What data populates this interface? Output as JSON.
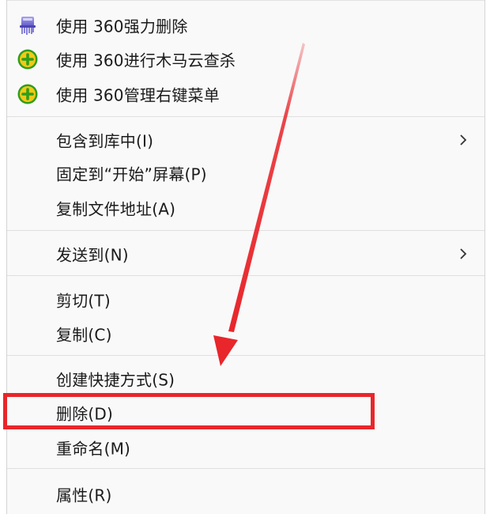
{
  "context_menu": {
    "items": [
      {
        "id": "force-delete",
        "label": "使用 360强力删除",
        "icon": "360-shredder-icon"
      },
      {
        "id": "trojan-scan",
        "label": "使用 360进行木马云查杀",
        "icon": "360-plus-icon"
      },
      {
        "id": "manage-menu",
        "label": "使用 360管理右键菜单",
        "icon": "360-plus-icon"
      },
      {
        "id": "include-library",
        "label": "包含到库中(I)",
        "submenu": true
      },
      {
        "id": "pin-start",
        "label": "固定到“开始”屏幕(P)"
      },
      {
        "id": "copy-path",
        "label": "复制文件地址(A)"
      },
      {
        "id": "send-to",
        "label": "发送到(N)",
        "submenu": true
      },
      {
        "id": "cut",
        "label": "剪切(T)"
      },
      {
        "id": "copy",
        "label": "复制(C)"
      },
      {
        "id": "create-shortcut",
        "label": "创建快捷方式(S)"
      },
      {
        "id": "delete",
        "label": "删除(D)"
      },
      {
        "id": "rename",
        "label": "重命名(M)"
      },
      {
        "id": "properties",
        "label": "属性(R)"
      }
    ]
  },
  "annotation": {
    "highlight_target": "delete",
    "highlight_color": "#e8262b",
    "arrow_color": "#e8262b"
  },
  "colors": {
    "menu_background": "#f9f9f9",
    "separator": "#e0e0e0",
    "icon_green": "#2e9e1b",
    "icon_yellow": "#f4c817",
    "icon_purple": "#7b74d6"
  }
}
